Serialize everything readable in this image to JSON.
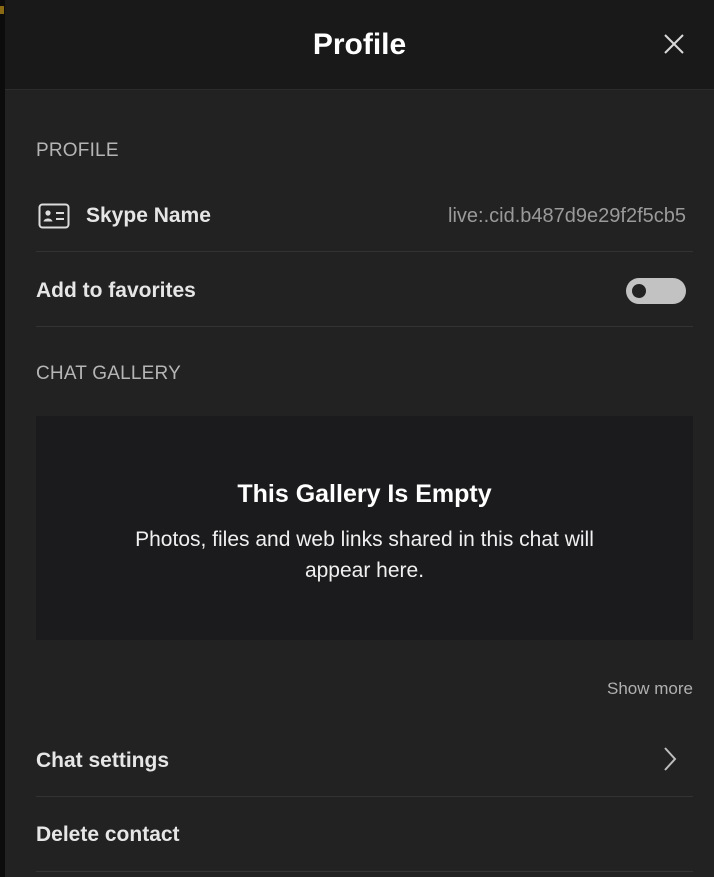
{
  "header": {
    "title": "Profile"
  },
  "profile_section": {
    "label": "PROFILE",
    "skype_name": {
      "icon": "contact-card-icon",
      "label": "Skype Name",
      "value": "live:.cid.b487d9e29f2f5cb5"
    },
    "favorites": {
      "label": "Add to favorites",
      "toggle_on": false
    }
  },
  "gallery_section": {
    "label": "CHAT GALLERY",
    "empty_title": "This Gallery Is Empty",
    "empty_text": "Photos, files and web links shared in this chat will appear here.",
    "show_more": "Show more"
  },
  "actions": {
    "chat_settings": "Chat settings",
    "delete_contact": "Delete contact"
  },
  "colors": {
    "panel_bg": "#222222",
    "header_bg": "#191919",
    "gallery_bg": "#1b1b1d",
    "toggle_off": "#c2c2c2"
  }
}
